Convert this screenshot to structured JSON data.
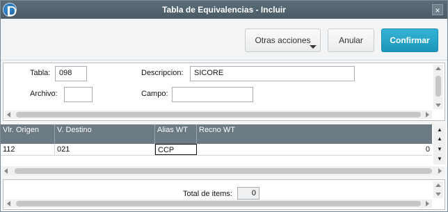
{
  "window": {
    "title": "Tabla de Equivalencias - Incluir",
    "close_glyph": "×"
  },
  "toolbar": {
    "other_actions_label": "Otras acciones",
    "cancel_label": "Anular",
    "confirm_label": "Confirmar"
  },
  "form": {
    "tabla_label": "Tabla:",
    "tabla_value": "098",
    "descripcion_label": "Descripcion:",
    "descripcion_value": "SICORE",
    "archivo_label": "Archivo:",
    "archivo_value": "",
    "campo_label": "Campo:",
    "campo_value": ""
  },
  "grid": {
    "columns": [
      "Vlr. Origen",
      "V. Destino",
      "Alias WT",
      "Recno WT"
    ],
    "rows": [
      {
        "vlr_origen": "112",
        "v_destino": "021",
        "alias_wt": "CCP",
        "recno_wt": "0"
      }
    ]
  },
  "footer": {
    "total_label": "Total de items:",
    "total_value": "0"
  },
  "colors": {
    "titlebar": "#4f606b",
    "confirm": "#1b95b9",
    "grid_header": "#6b7a83"
  },
  "icons": {
    "app": "totvs-app-icon",
    "close": "close-icon",
    "nav_first": "double-up-arrow-icon",
    "nav_up": "up-arrow-icon",
    "nav_down": "down-arrow-icon",
    "nav_last": "double-down-arrow-icon"
  }
}
